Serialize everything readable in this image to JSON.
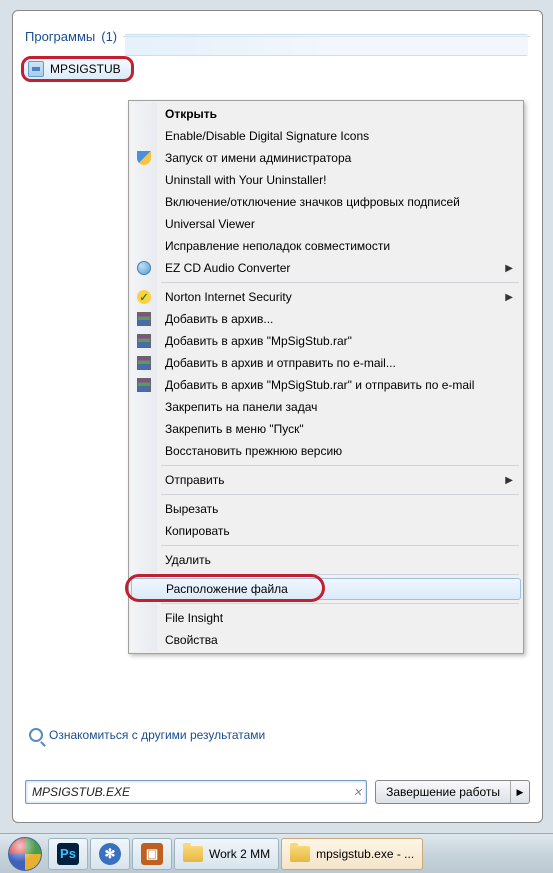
{
  "section": {
    "header": "Программы",
    "count": "(1)"
  },
  "result": {
    "name": "MPSIGSTUB"
  },
  "menu": [
    {
      "label": "Открыть",
      "bold": true
    },
    {
      "label": "Enable/Disable Digital Signature Icons"
    },
    {
      "label": "Запуск от имени администратора",
      "icon": "shield"
    },
    {
      "label": "Uninstall with Your Uninstaller!"
    },
    {
      "label": "Включение/отключение значков цифровых подписей"
    },
    {
      "label": "Universal Viewer"
    },
    {
      "label": "Исправление неполадок совместимости"
    },
    {
      "label": "EZ CD Audio Converter",
      "icon": "globe",
      "arrow": true
    },
    {
      "sep": true
    },
    {
      "label": "Norton Internet Security",
      "icon": "norton",
      "arrow": true
    },
    {
      "label": "Добавить в архив...",
      "icon": "rar"
    },
    {
      "label": "Добавить в архив \"MpSigStub.rar\"",
      "icon": "rar"
    },
    {
      "label": "Добавить в архив и отправить по e-mail...",
      "icon": "rar"
    },
    {
      "label": "Добавить в архив \"MpSigStub.rar\" и отправить по e-mail",
      "icon": "rar"
    },
    {
      "label": "Закрепить на панели задач"
    },
    {
      "label": "Закрепить в меню \"Пуск\""
    },
    {
      "label": "Восстановить прежнюю версию"
    },
    {
      "sep": true
    },
    {
      "label": "Отправить",
      "arrow": true
    },
    {
      "sep": true
    },
    {
      "label": "Вырезать"
    },
    {
      "label": "Копировать"
    },
    {
      "sep": true
    },
    {
      "label": "Удалить"
    },
    {
      "sep": true
    },
    {
      "label": "Расположение файла",
      "highlighted": true
    },
    {
      "sep": true
    },
    {
      "label": "File Insight"
    },
    {
      "label": "Свойства"
    }
  ],
  "see_more": "Ознакомиться с другими результатами",
  "search": {
    "value": "MPSIGSTUB.EXE"
  },
  "shutdown": {
    "label": "Завершение работы"
  },
  "taskbar": {
    "items": [
      {
        "label": "Work 2 MM"
      },
      {
        "label": "mpsigstub.exe - ..."
      }
    ]
  }
}
